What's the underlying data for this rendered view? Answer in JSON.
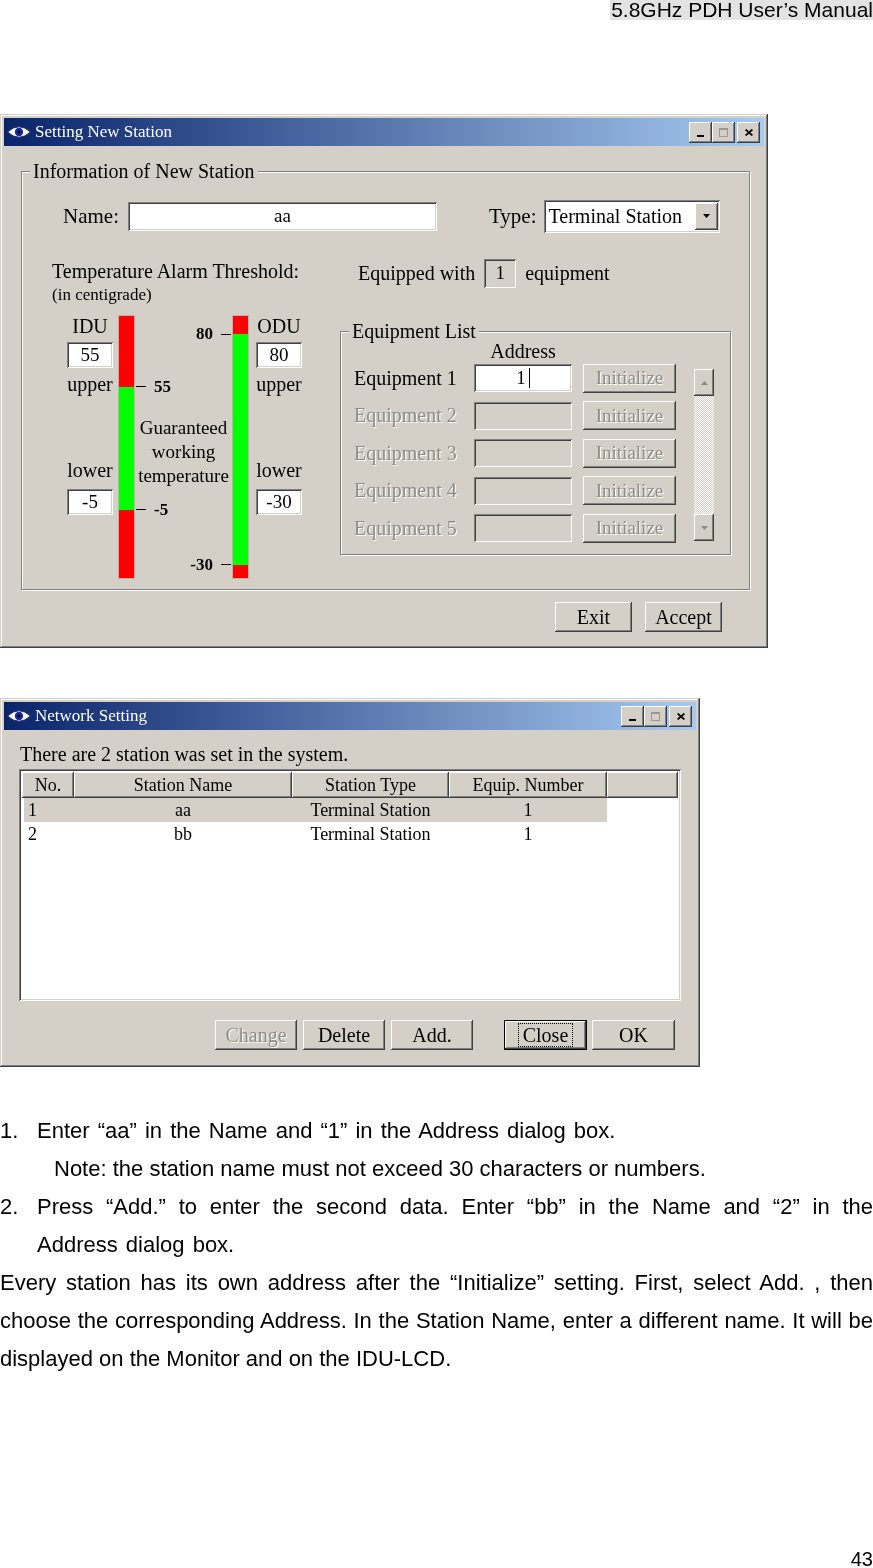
{
  "page_header": "5.8GHz PDH User’s Manual",
  "setting_dialog": {
    "window": {
      "title": "Setting New Station",
      "maximize_disabled": true
    },
    "info_group": {
      "legend": "Information of New Station",
      "name": {
        "label": "Name:",
        "value": "aa"
      },
      "type": {
        "label": "Type:",
        "value": "Terminal Station"
      },
      "temperature": {
        "label": "Temperature Alarm Threshold:",
        "note": "(in centigrade)",
        "idu": {
          "title": "IDU",
          "upper": "55",
          "upper_label": "upper",
          "lower_label": "lower",
          "lower": "-5",
          "upper_alarm_band": {
            "level": 0.27
          },
          "lower_alarm_band": {
            "level": 0.26
          },
          "upper_tick": "55",
          "lower_tick": "-5"
        },
        "band_label": "Guaranteed working temperature",
        "odu": {
          "title": "ODU",
          "upper": "80",
          "upper_label": "upper",
          "lower_label": "lower",
          "lower": "-30",
          "upper_alarm_band": {
            "level": 0.07
          },
          "lower_alarm_band": {
            "level": 0.05
          },
          "upper_tick": "80",
          "lower_tick": "-30"
        }
      },
      "equipped": {
        "prefix": "Equipped with",
        "value": "1",
        "suffix": "equipment",
        "disabled": true
      },
      "equipment_list": {
        "legend": "Equipment List",
        "column": "Address",
        "rows": [
          {
            "label": "Equipment 1",
            "address": "1",
            "disabled": false,
            "focused": true,
            "button": "Initialize",
            "button_disabled": true
          },
          {
            "label": "Equipment 2",
            "disabled": true,
            "focused": false,
            "button": "Initialize",
            "button_disabled": true
          },
          {
            "label": "Equipment 3",
            "disabled": true,
            "focused": false,
            "button": "Initialize",
            "button_disabled": true
          },
          {
            "label": "Equipment 4",
            "disabled": true,
            "focused": false,
            "button": "Initialize",
            "button_disabled": true
          },
          {
            "label": "Equipment 5",
            "disabled": true,
            "focused": false,
            "button": "Initialize",
            "button_disabled": true
          }
        ]
      }
    },
    "buttons": [
      "Exit",
      "Accept"
    ]
  },
  "network_dialog": {
    "window": {
      "title": "Network Setting",
      "maximize_disabled": true
    },
    "message": "There are 2 station was set in the system.",
    "table": {
      "columns": [
        "No.",
        "Station Name",
        "Station Type",
        "Equip. Number"
      ],
      "rows": [
        {
          "cells": [
            "1",
            "aa",
            "Terminal Station",
            "1"
          ],
          "selected": true
        },
        {
          "cells": [
            "2",
            "bb",
            "Terminal Station",
            "1"
          ],
          "selected": false
        }
      ]
    },
    "edit_buttons": [
      {
        "label": "Change",
        "disabled": true
      },
      {
        "label": "Delete",
        "disabled": false
      },
      {
        "label": "Add.",
        "disabled": false
      }
    ],
    "dialog_buttons": [
      {
        "label": "Close",
        "focused": true
      },
      {
        "label": "OK",
        "focused": false
      }
    ]
  },
  "instructions": [
    {
      "number": "1.",
      "text": "Enter “aa” in the Name and “1” in the Address dialog box.",
      "note": "Note: the station name must not exceed 30 characters or numbers."
    },
    {
      "number": "2.",
      "text": "Press “Add.” to enter the second data. Enter “bb” in the Name and “2” in the Address dialog box."
    }
  ],
  "paragraph": "Every station has its own address after the “Initialize” setting. First, select Add. , then choose the corresponding Address. In the Station Name, enter a different name. It will be displayed on the Monitor and on the IDU-LCD.",
  "page_number": "43"
}
